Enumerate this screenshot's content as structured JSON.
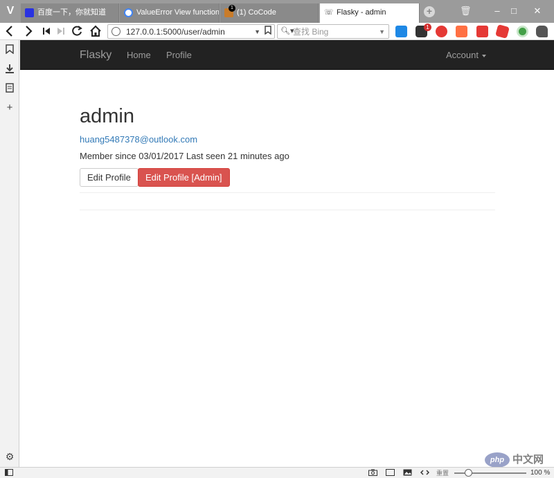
{
  "browser": {
    "logo": "V",
    "tabs": [
      {
        "title": "百度一下，你就知道",
        "favicon_color": "#2932e1"
      },
      {
        "title": "ValueError View function",
        "favicon_color": "#4285f4"
      },
      {
        "title": "(1) CoCode",
        "favicon_color": "#c97c2a",
        "badge": "1"
      },
      {
        "title": "Flasky - admin",
        "favicon_color": "#555555",
        "active": true
      }
    ],
    "new_tab_label": "+",
    "window_controls": [
      "–",
      "□",
      "✕"
    ],
    "address": {
      "url": "127.0.0.1:5000/user/admin"
    },
    "search": {
      "placeholder": "查找 Bing"
    },
    "extensions": [
      {
        "name": "translate-extension",
        "color": "#1e88e5"
      },
      {
        "name": "mail-extension",
        "color": "#333333",
        "badge": "1"
      },
      {
        "name": "opera-extension",
        "color": "#e53935"
      },
      {
        "name": "hatena-extension",
        "color": "#ff7043"
      },
      {
        "name": "dots-extension",
        "color": "#e53935"
      },
      {
        "name": "red-shape-extension",
        "color": "#e53935"
      },
      {
        "name": "green-circle-extension",
        "color": "#43a047"
      },
      {
        "name": "evernote-extension",
        "color": "#555555"
      }
    ],
    "status": {
      "zoom_label": "重置",
      "zoom_value": "100 %",
      "zoom_level_percent": 100
    }
  },
  "site": {
    "brand": "Flasky",
    "nav": {
      "home": "Home",
      "profile": "Profile",
      "account": "Account"
    }
  },
  "profile": {
    "username": "admin",
    "email": "huang5487378@outlook.com",
    "member_line": "Member since 03/01/2017 Last seen 21 minutes ago",
    "edit_button": "Edit Profile",
    "edit_admin_button": "Edit Profile [Admin]"
  },
  "watermark": {
    "logo_text": "php",
    "site_text": "中文网"
  }
}
